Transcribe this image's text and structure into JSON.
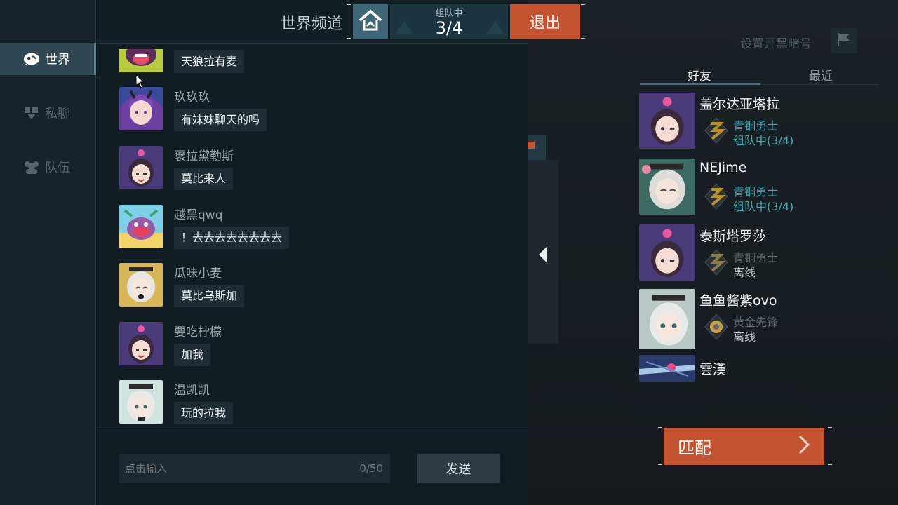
{
  "nav": {
    "world": "世界",
    "private": "私聊",
    "team": "队伍"
  },
  "header": {
    "channel_title": "世界频道",
    "team_status_label": "组队中",
    "team_count": "3/4",
    "exit_label": "退出"
  },
  "messages": [
    {
      "name": "",
      "text": "天狼拉有麦"
    },
    {
      "name": "玖玖玖",
      "text": "有妹妹聊天的吗"
    },
    {
      "name": "褒拉黛勒斯",
      "text": "莫比来人"
    },
    {
      "name": "越黑qwq",
      "text": "！去去去去去去去去"
    },
    {
      "name": "瓜味小麦",
      "text": "莫比乌斯加"
    },
    {
      "name": "要吃柠檬",
      "text": "加我"
    },
    {
      "name": "温凯凯",
      "text": "玩的拉我"
    }
  ],
  "input": {
    "placeholder": "点击输入",
    "counter": "0/50",
    "send_label": "发送"
  },
  "right": {
    "secret_label": "设置开黑暗号",
    "tab_friends": "好友",
    "tab_recent": "最近",
    "friends": [
      {
        "name": "盖尔达亚塔拉",
        "rank": "青铜勇士",
        "status": "组队中(3/4)"
      },
      {
        "name": "NEJime",
        "rank": "青铜勇士",
        "status": "组队中(3/4)"
      },
      {
        "name": "泰斯塔罗莎",
        "rank": "青铜勇士",
        "status": "离线"
      },
      {
        "name": "鱼鱼酱紫ovo",
        "rank": "黄金先锋",
        "status": "离线"
      },
      {
        "name": "雲漢",
        "rank": "",
        "status": ""
      }
    ],
    "match_label": "匹配"
  },
  "colors": {
    "accent_orange": "#c4532f",
    "accent_teal": "#3fa8b0",
    "home_blue": "#3e6676"
  }
}
